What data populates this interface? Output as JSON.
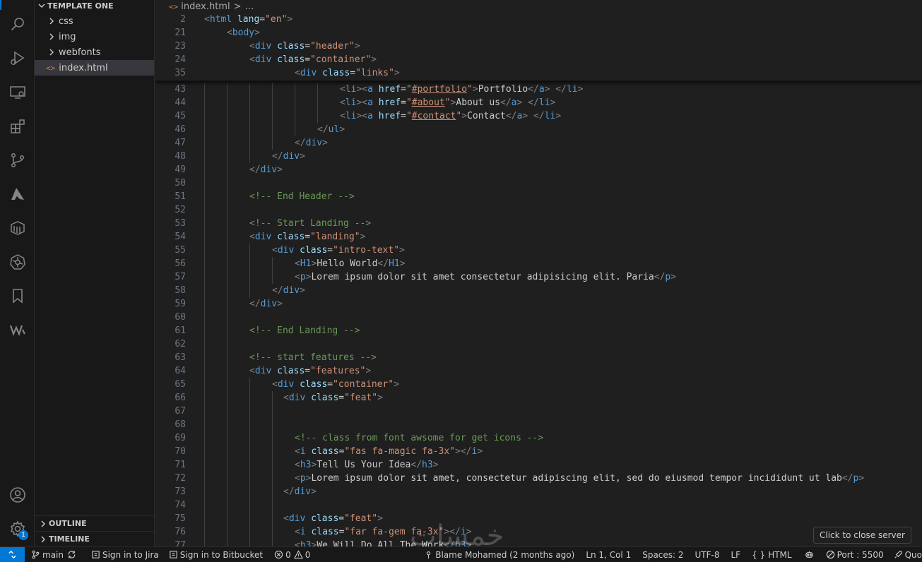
{
  "explorer": {
    "folder": "TEMPLATE ONE",
    "items": [
      {
        "label": "css"
      },
      {
        "label": "img"
      },
      {
        "label": "webfonts"
      },
      {
        "label": "index.html"
      }
    ],
    "outline": "OUTLINE",
    "timeline": "TIMELINE"
  },
  "breadcrumb": {
    "file": "index.html",
    "sep": ">",
    "rest": "…"
  },
  "sticky_lines": [
    {
      "n": "2",
      "indent": 0,
      "tokens": [
        [
          "t-br",
          "<"
        ],
        [
          "t-tag",
          "html"
        ],
        [
          "t-txt",
          " "
        ],
        [
          "t-attr",
          "lang"
        ],
        [
          "t-txt",
          "="
        ],
        [
          "t-str",
          "\"en\""
        ],
        [
          "t-br",
          ">"
        ]
      ]
    },
    {
      "n": "21",
      "indent": 1,
      "tokens": [
        [
          "t-br",
          "<"
        ],
        [
          "t-tag",
          "body"
        ],
        [
          "t-br",
          ">"
        ]
      ]
    },
    {
      "n": "23",
      "indent": 2,
      "tokens": [
        [
          "t-br",
          "<"
        ],
        [
          "t-tag",
          "div"
        ],
        [
          "t-txt",
          " "
        ],
        [
          "t-attr",
          "class"
        ],
        [
          "t-txt",
          "="
        ],
        [
          "t-str",
          "\"header\""
        ],
        [
          "t-br",
          ">"
        ]
      ]
    },
    {
      "n": "24",
      "indent": 2,
      "tokens": [
        [
          "t-br",
          "<"
        ],
        [
          "t-tag",
          "div"
        ],
        [
          "t-txt",
          " "
        ],
        [
          "t-attr",
          "class"
        ],
        [
          "t-txt",
          "="
        ],
        [
          "t-str",
          "\"container\""
        ],
        [
          "t-br",
          ">"
        ]
      ]
    },
    {
      "n": "35",
      "indent": 4,
      "tokens": [
        [
          "t-br",
          "<"
        ],
        [
          "t-tag",
          "div"
        ],
        [
          "t-txt",
          " "
        ],
        [
          "t-attr",
          "class"
        ],
        [
          "t-txt",
          "="
        ],
        [
          "t-str",
          "\"links\""
        ],
        [
          "t-br",
          ">"
        ]
      ]
    }
  ],
  "lines": [
    {
      "n": "43",
      "guides": 6,
      "indent": 6,
      "tokens": [
        [
          "t-br",
          "<"
        ],
        [
          "t-tag",
          "li"
        ],
        [
          "t-br",
          "><"
        ],
        [
          "t-tag",
          "a"
        ],
        [
          "t-txt",
          " "
        ],
        [
          "t-attr",
          "href"
        ],
        [
          "t-txt",
          "="
        ],
        [
          "t-str",
          "\""
        ],
        [
          "t-str t-link",
          "#portfolio"
        ],
        [
          "t-str",
          "\""
        ],
        [
          "t-br",
          ">"
        ],
        [
          "t-txt",
          "Portfolio"
        ],
        [
          "t-br",
          "</"
        ],
        [
          "t-tag",
          "a"
        ],
        [
          "t-br",
          "> </"
        ],
        [
          "t-tag",
          "li"
        ],
        [
          "t-br",
          ">"
        ]
      ]
    },
    {
      "n": "44",
      "guides": 6,
      "indent": 6,
      "tokens": [
        [
          "t-br",
          "<"
        ],
        [
          "t-tag",
          "li"
        ],
        [
          "t-br",
          "><"
        ],
        [
          "t-tag",
          "a"
        ],
        [
          "t-txt",
          " "
        ],
        [
          "t-attr",
          "href"
        ],
        [
          "t-txt",
          "="
        ],
        [
          "t-str",
          "\""
        ],
        [
          "t-str t-link",
          "#about"
        ],
        [
          "t-str",
          "\""
        ],
        [
          "t-br",
          ">"
        ],
        [
          "t-txt",
          "About us"
        ],
        [
          "t-br",
          "</"
        ],
        [
          "t-tag",
          "a"
        ],
        [
          "t-br",
          "> </"
        ],
        [
          "t-tag",
          "li"
        ],
        [
          "t-br",
          ">"
        ]
      ]
    },
    {
      "n": "45",
      "guides": 6,
      "indent": 6,
      "tokens": [
        [
          "t-br",
          "<"
        ],
        [
          "t-tag",
          "li"
        ],
        [
          "t-br",
          "><"
        ],
        [
          "t-tag",
          "a"
        ],
        [
          "t-txt",
          " "
        ],
        [
          "t-attr",
          "href"
        ],
        [
          "t-txt",
          "="
        ],
        [
          "t-str",
          "\""
        ],
        [
          "t-str t-link",
          "#contact"
        ],
        [
          "t-str",
          "\""
        ],
        [
          "t-br",
          ">"
        ],
        [
          "t-txt",
          "Contact"
        ],
        [
          "t-br",
          "</"
        ],
        [
          "t-tag",
          "a"
        ],
        [
          "t-br",
          "> </"
        ],
        [
          "t-tag",
          "li"
        ],
        [
          "t-br",
          ">"
        ]
      ]
    },
    {
      "n": "46",
      "guides": 5,
      "indent": 5,
      "tokens": [
        [
          "t-br",
          "</"
        ],
        [
          "t-tag",
          "ul"
        ],
        [
          "t-br",
          ">"
        ]
      ]
    },
    {
      "n": "47",
      "guides": 4,
      "indent": 4,
      "tokens": [
        [
          "t-br",
          "</"
        ],
        [
          "t-tag",
          "div"
        ],
        [
          "t-br",
          ">"
        ]
      ]
    },
    {
      "n": "48",
      "guides": 3,
      "indent": 3,
      "tokens": [
        [
          "t-br",
          "</"
        ],
        [
          "t-tag",
          "div"
        ],
        [
          "t-br",
          ">"
        ]
      ]
    },
    {
      "n": "49",
      "guides": 2,
      "indent": 2,
      "tokens": [
        [
          "t-br",
          "</"
        ],
        [
          "t-tag",
          "div"
        ],
        [
          "t-br",
          ">"
        ]
      ]
    },
    {
      "n": "50",
      "guides": 2,
      "indent": 2,
      "tokens": []
    },
    {
      "n": "51",
      "guides": 2,
      "indent": 2,
      "tokens": [
        [
          "t-com",
          "<!-- End Header -->"
        ]
      ]
    },
    {
      "n": "52",
      "guides": 2,
      "indent": 2,
      "tokens": []
    },
    {
      "n": "53",
      "guides": 2,
      "indent": 2,
      "tokens": [
        [
          "t-com",
          "<!-- Start Landing -->"
        ]
      ]
    },
    {
      "n": "54",
      "guides": 2,
      "indent": 2,
      "tokens": [
        [
          "t-br",
          "<"
        ],
        [
          "t-tag",
          "div"
        ],
        [
          "t-txt",
          " "
        ],
        [
          "t-attr",
          "class"
        ],
        [
          "t-txt",
          "="
        ],
        [
          "t-str",
          "\"landing\""
        ],
        [
          "t-br",
          ">"
        ]
      ]
    },
    {
      "n": "55",
      "guides": 3,
      "indent": 3,
      "tokens": [
        [
          "t-br",
          "<"
        ],
        [
          "t-tag",
          "div"
        ],
        [
          "t-txt",
          " "
        ],
        [
          "t-attr",
          "class"
        ],
        [
          "t-txt",
          "="
        ],
        [
          "t-str",
          "\"intro-text\""
        ],
        [
          "t-br",
          ">"
        ]
      ]
    },
    {
      "n": "56",
      "guides": 4,
      "indent": 4,
      "tokens": [
        [
          "t-br",
          "<"
        ],
        [
          "t-tag",
          "H1"
        ],
        [
          "t-br",
          ">"
        ],
        [
          "t-txt",
          "Hello World"
        ],
        [
          "t-br",
          "</"
        ],
        [
          "t-tag",
          "H1"
        ],
        [
          "t-br",
          ">"
        ]
      ]
    },
    {
      "n": "57",
      "guides": 4,
      "indent": 4,
      "tokens": [
        [
          "t-br",
          "<"
        ],
        [
          "t-tag",
          "p"
        ],
        [
          "t-br",
          ">"
        ],
        [
          "t-txt",
          "Lorem ipsum dolor sit amet consectetur adipisicing elit. Paria"
        ],
        [
          "t-br",
          "</"
        ],
        [
          "t-tag",
          "p"
        ],
        [
          "t-br",
          ">"
        ]
      ]
    },
    {
      "n": "58",
      "guides": 3,
      "indent": 3,
      "tokens": [
        [
          "t-br",
          "</"
        ],
        [
          "t-tag",
          "div"
        ],
        [
          "t-br",
          ">"
        ]
      ]
    },
    {
      "n": "59",
      "guides": 2,
      "indent": 2,
      "tokens": [
        [
          "t-br",
          "</"
        ],
        [
          "t-tag",
          "div"
        ],
        [
          "t-br",
          ">"
        ]
      ]
    },
    {
      "n": "60",
      "guides": 2,
      "indent": 2,
      "tokens": []
    },
    {
      "n": "61",
      "guides": 2,
      "indent": 2,
      "tokens": [
        [
          "t-com",
          "<!-- End Landing -->"
        ]
      ]
    },
    {
      "n": "62",
      "guides": 2,
      "indent": 2,
      "tokens": []
    },
    {
      "n": "63",
      "guides": 2,
      "indent": 2,
      "tokens": [
        [
          "t-com",
          "<!-- start features -->"
        ]
      ]
    },
    {
      "n": "64",
      "guides": 2,
      "indent": 2,
      "tokens": [
        [
          "t-br",
          "<"
        ],
        [
          "t-tag",
          "div"
        ],
        [
          "t-txt",
          " "
        ],
        [
          "t-attr",
          "class"
        ],
        [
          "t-txt",
          "="
        ],
        [
          "t-str",
          "\"features\""
        ],
        [
          "t-br",
          ">"
        ]
      ]
    },
    {
      "n": "65",
      "guides": 3,
      "indent": 3,
      "tokens": [
        [
          "t-br",
          "<"
        ],
        [
          "t-tag",
          "div"
        ],
        [
          "t-txt",
          " "
        ],
        [
          "t-attr",
          "class"
        ],
        [
          "t-txt",
          "="
        ],
        [
          "t-str",
          "\"container\""
        ],
        [
          "t-br",
          ">"
        ]
      ]
    },
    {
      "n": "66",
      "guides": 3.5,
      "indent": 3.5,
      "tokens": [
        [
          "t-br",
          "<"
        ],
        [
          "t-tag",
          "div"
        ],
        [
          "t-txt",
          " "
        ],
        [
          "t-attr",
          "class"
        ],
        [
          "t-txt",
          "="
        ],
        [
          "t-str",
          "\"feat\""
        ],
        [
          "t-br",
          ">"
        ]
      ]
    },
    {
      "n": "67",
      "guides": 4,
      "indent": 4,
      "tokens": []
    },
    {
      "n": "68",
      "guides": 4,
      "indent": 4,
      "tokens": []
    },
    {
      "n": "69",
      "guides": 4,
      "indent": 4,
      "tokens": [
        [
          "t-com",
          "<!-- class from font awsome for get icons -->"
        ]
      ]
    },
    {
      "n": "70",
      "guides": 4,
      "indent": 4,
      "tokens": [
        [
          "t-br",
          "<"
        ],
        [
          "t-tag",
          "i"
        ],
        [
          "t-txt",
          " "
        ],
        [
          "t-attr",
          "class"
        ],
        [
          "t-txt",
          "="
        ],
        [
          "t-str",
          "\"fas fa-magic fa-3x\""
        ],
        [
          "t-br",
          "></"
        ],
        [
          "t-tag",
          "i"
        ],
        [
          "t-br",
          ">"
        ]
      ]
    },
    {
      "n": "71",
      "guides": 4,
      "indent": 4,
      "tokens": [
        [
          "t-br",
          "<"
        ],
        [
          "t-tag",
          "h3"
        ],
        [
          "t-br",
          ">"
        ],
        [
          "t-txt",
          "Tell Us Your Idea"
        ],
        [
          "t-br",
          "</"
        ],
        [
          "t-tag",
          "h3"
        ],
        [
          "t-br",
          ">"
        ]
      ]
    },
    {
      "n": "72",
      "guides": 4,
      "indent": 4,
      "tokens": [
        [
          "t-br",
          "<"
        ],
        [
          "t-tag",
          "p"
        ],
        [
          "t-br",
          ">"
        ],
        [
          "t-txt",
          "Lorem ipsum dolor sit amet, consectetur adipiscing elit, sed do eiusmod tempor incididunt ut lab"
        ],
        [
          "t-br",
          "</"
        ],
        [
          "t-tag",
          "p"
        ],
        [
          "t-br",
          ">"
        ]
      ]
    },
    {
      "n": "73",
      "guides": 3.5,
      "indent": 3.5,
      "tokens": [
        [
          "t-br",
          "</"
        ],
        [
          "t-tag",
          "div"
        ],
        [
          "t-br",
          ">"
        ]
      ]
    },
    {
      "n": "74",
      "guides": 3.5,
      "indent": 3.5,
      "tokens": []
    },
    {
      "n": "75",
      "guides": 3.5,
      "indent": 3.5,
      "tokens": [
        [
          "t-br",
          "<"
        ],
        [
          "t-tag",
          "div"
        ],
        [
          "t-txt",
          " "
        ],
        [
          "t-attr",
          "class"
        ],
        [
          "t-txt",
          "="
        ],
        [
          "t-str",
          "\"feat\""
        ],
        [
          "t-br",
          ">"
        ]
      ]
    },
    {
      "n": "76",
      "guides": 4,
      "indent": 4,
      "tokens": [
        [
          "t-br",
          "<"
        ],
        [
          "t-tag",
          "i"
        ],
        [
          "t-txt",
          " "
        ],
        [
          "t-attr",
          "class"
        ],
        [
          "t-txt",
          "="
        ],
        [
          "t-str",
          "\"far fa-gem fa-3x\""
        ],
        [
          "t-br",
          "></"
        ],
        [
          "t-tag",
          "i"
        ],
        [
          "t-br",
          ">"
        ]
      ]
    },
    {
      "n": "77",
      "guides": 4,
      "indent": 4,
      "tokens": [
        [
          "t-br",
          "<"
        ],
        [
          "t-tag",
          "h3"
        ],
        [
          "t-br",
          ">"
        ],
        [
          "t-txt",
          "We Will Do All The Work"
        ],
        [
          "t-br",
          "</"
        ],
        [
          "t-tag",
          "h3"
        ],
        [
          "t-br",
          ">"
        ]
      ]
    }
  ],
  "status": {
    "branch": "main",
    "jira": "Sign in to Jira",
    "bitbucket": "Sign in to Bitbucket",
    "errors": "0",
    "warnings": "0",
    "blame": "Blame Mohamed (2 months ago)",
    "position": "Ln 1, Col 1",
    "spaces": "Spaces: 2",
    "encoding": "UTF-8",
    "eol": "LF",
    "language": "HTML",
    "language_prefix": "{ }",
    "port": "Port : 5500",
    "quokka": "Quo"
  },
  "tooltip": "Click to close server",
  "watermark": "خمسات",
  "badge_count": "1",
  "icons": [
    "search-icon",
    "run-debug-icon",
    "remote-explorer-icon",
    "extensions-icon",
    "source-control-icon",
    "azure-icon",
    "docker-icon",
    "kubernetes-icon",
    "bookmark-icon",
    "wallaby-icon",
    "account-icon",
    "settings-icon"
  ]
}
